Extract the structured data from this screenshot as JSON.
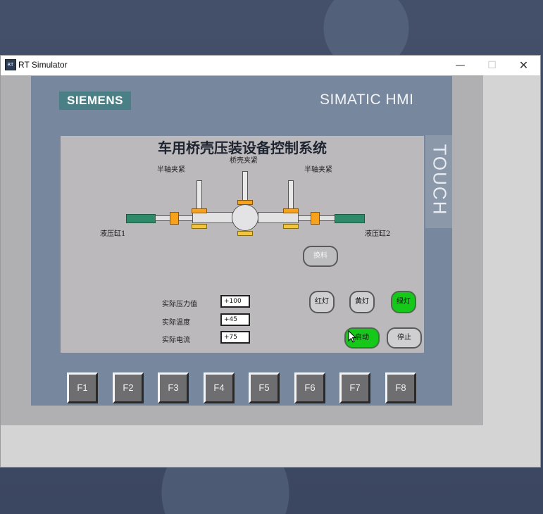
{
  "window": {
    "icon_text": "RT",
    "title": "RT Simulator",
    "minimize": "—",
    "maximize": "☐",
    "close": "✕"
  },
  "panel": {
    "brand": "SIEMENS",
    "product": "SIMATIC HMI",
    "touch": "TOUCH"
  },
  "screen": {
    "title": "车用桥壳压装设备控制系统",
    "labels": {
      "left_clamp": "半轴夹紧",
      "center_clamp": "桥壳夹紧",
      "right_clamp": "半轴夹紧",
      "cyl1": "液压缸1",
      "cyl2": "液压缸2"
    },
    "buttons": {
      "change": "换料",
      "red": "红灯",
      "yellow": "黄灯",
      "green": "绿灯",
      "start": "启动",
      "stop": "停止"
    },
    "readouts": [
      {
        "label": "实际压力值",
        "value": "+100"
      },
      {
        "label": "实际温度",
        "value": "+45"
      },
      {
        "label": "实际电流",
        "value": "+75"
      }
    ],
    "colors": {
      "active_green": "#16c81a",
      "cylinder_green": "#2e8b6a",
      "block_orange": "#f6a21c"
    }
  },
  "fkeys": [
    "F1",
    "F2",
    "F3",
    "F4",
    "F5",
    "F6",
    "F7",
    "F8"
  ]
}
